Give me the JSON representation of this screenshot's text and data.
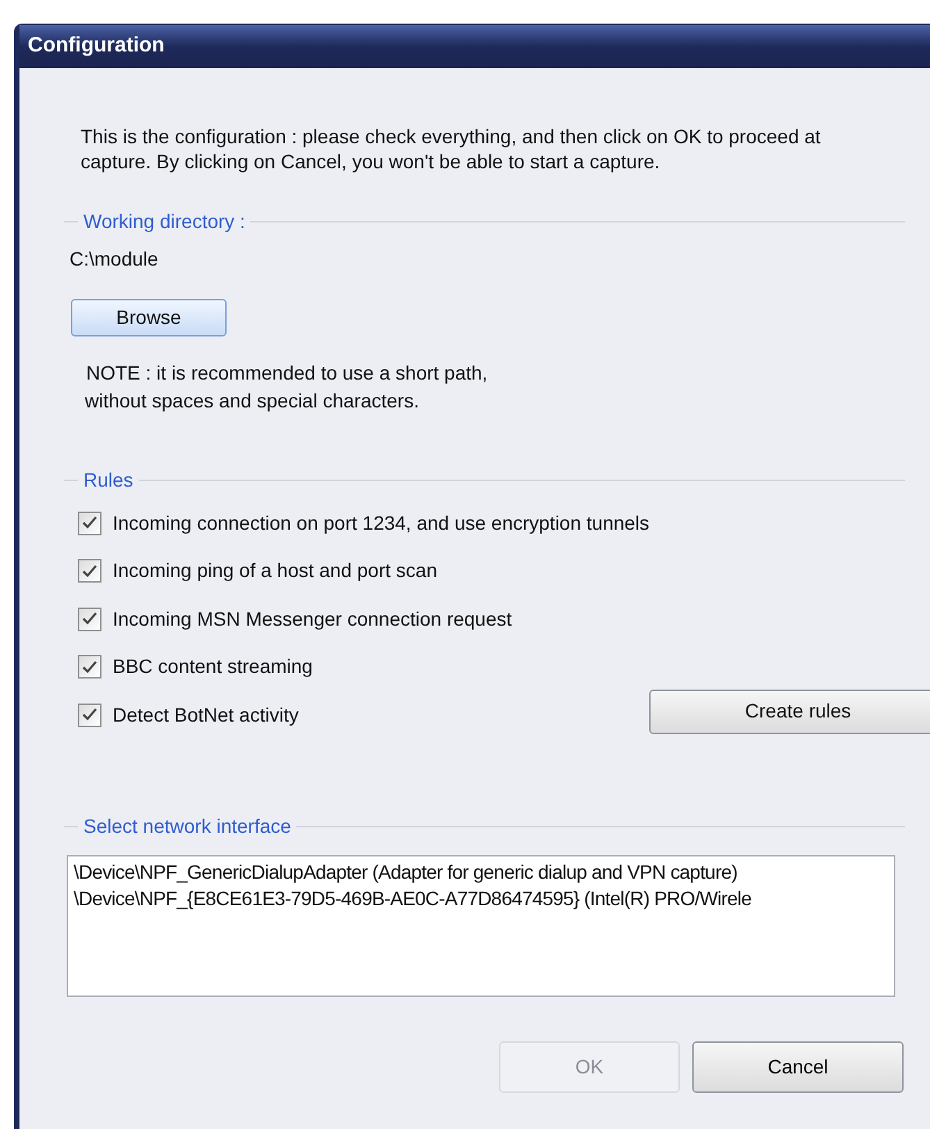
{
  "window": {
    "title": "Configuration"
  },
  "intro": "This is the configuration : please check everything, and then click on OK to proceed at capture. By clicking on Cancel, you won't be able to start a capture.",
  "working_directory": {
    "legend": "Working directory :",
    "path": "C:\\module",
    "browse_button": "Browse",
    "note_lines": [
      "NOTE : it is recommended to use a short path,",
      "without spaces and special characters."
    ]
  },
  "rules": {
    "legend": "Rules",
    "items": [
      {
        "label": "Incoming connection on port 1234, and use encryption tunnels",
        "checked": true
      },
      {
        "label": "Incoming ping of a host and port scan",
        "checked": true
      },
      {
        "label": "Incoming MSN Messenger connection request",
        "checked": true
      },
      {
        "label": "BBC content streaming",
        "checked": true
      },
      {
        "label": "Detect BotNet activity",
        "checked": true
      }
    ],
    "create_button": "Create rules"
  },
  "network": {
    "legend": "Select network interface",
    "interfaces": [
      {
        "label": "\\Device\\NPF_GenericDialupAdapter (Adapter for generic dialup and VPN capture)",
        "selected": false
      },
      {
        "label": "\\Device\\NPF_{E8CE61E3-79D5-469B-AE0C-A77D86474595} (Intel(R) PRO/Wirele",
        "selected": false
      }
    ]
  },
  "buttons": [
    {
      "label": "OK",
      "disabled": true
    },
    {
      "label": "Cancel",
      "disabled": false
    }
  ]
}
